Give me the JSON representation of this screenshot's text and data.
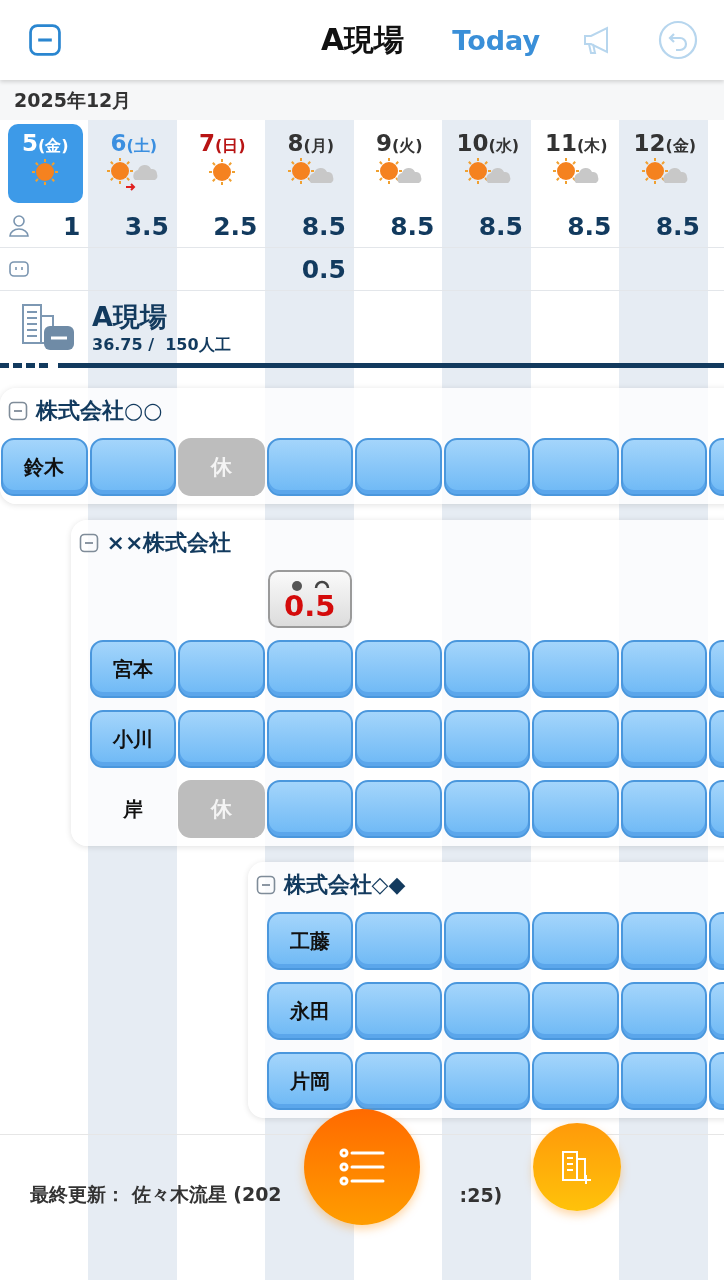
{
  "header": {
    "title": "A現場",
    "today": "Today"
  },
  "month": "2025年12月",
  "days": [
    {
      "day": "5",
      "weekday": "(金)",
      "color": "#ffffff",
      "selected": true,
      "weather": {
        "kind": "sunny"
      },
      "workers": "1"
    },
    {
      "day": "6",
      "weekday": "(土)",
      "color": "#3b8fe0",
      "selected": false,
      "weather": {
        "kind": "sunny_to_cloudy"
      },
      "workers": "3.5"
    },
    {
      "day": "7",
      "weekday": "(日)",
      "color": "#b81414",
      "selected": false,
      "weather": {
        "kind": "sunny"
      },
      "workers": "2.5"
    },
    {
      "day": "8",
      "weekday": "(月)",
      "color": "#333333",
      "selected": false,
      "weather": {
        "kind": "sunny_cloudy"
      },
      "workers": "8.5",
      "extra": "0.5"
    },
    {
      "day": "9",
      "weekday": "(火)",
      "color": "#333333",
      "selected": false,
      "weather": {
        "kind": "sunny_cloudy"
      },
      "workers": "8.5"
    },
    {
      "day": "10",
      "weekday": "(水)",
      "color": "#333333",
      "selected": false,
      "weather": {
        "kind": "sunny_cloudy"
      },
      "workers": "8.5"
    },
    {
      "day": "11",
      "weekday": "(木)",
      "color": "#333333",
      "selected": false,
      "weather": {
        "kind": "sunny_cloudy"
      },
      "workers": "8.5"
    },
    {
      "day": "12",
      "weekday": "(金)",
      "color": "#333333",
      "selected": false,
      "weather": {
        "kind": "sunny_cloudy"
      },
      "workers": "8.5"
    }
  ],
  "site": {
    "name": "A現場",
    "summary": "36.75 /  150人工"
  },
  "groups": [
    {
      "name": "株式会社○○",
      "expanded": true,
      "rows": [
        {
          "cells": [
            {
              "kind": "name",
              "text": "鈴木",
              "highlighted": true
            },
            {
              "kind": "work"
            },
            {
              "kind": "off",
              "text": "休"
            },
            {
              "kind": "work"
            },
            {
              "kind": "work"
            },
            {
              "kind": "work"
            },
            {
              "kind": "work"
            },
            {
              "kind": "work"
            },
            {
              "kind": "work"
            }
          ]
        }
      ]
    },
    {
      "name": "××株式会社",
      "expanded": true,
      "rows": [
        {
          "cells": [
            {
              "kind": "empty"
            },
            {
              "kind": "empty"
            },
            {
              "kind": "empty"
            },
            {
              "kind": "badge",
              "text": "0.5"
            }
          ]
        },
        {
          "cells": [
            {
              "kind": "empty"
            },
            {
              "kind": "name",
              "text": "宮本",
              "highlighted": true
            },
            {
              "kind": "work"
            },
            {
              "kind": "work"
            },
            {
              "kind": "work"
            },
            {
              "kind": "work"
            },
            {
              "kind": "work"
            },
            {
              "kind": "work"
            },
            {
              "kind": "work"
            }
          ]
        },
        {
          "cells": [
            {
              "kind": "empty"
            },
            {
              "kind": "name",
              "text": "小川",
              "highlighted": true
            },
            {
              "kind": "work"
            },
            {
              "kind": "work"
            },
            {
              "kind": "work"
            },
            {
              "kind": "work"
            },
            {
              "kind": "work"
            },
            {
              "kind": "work"
            },
            {
              "kind": "work"
            }
          ]
        },
        {
          "cells": [
            {
              "kind": "empty"
            },
            {
              "kind": "name",
              "text": "岸",
              "highlighted": false
            },
            {
              "kind": "off",
              "text": "休"
            },
            {
              "kind": "work"
            },
            {
              "kind": "work"
            },
            {
              "kind": "work"
            },
            {
              "kind": "work"
            },
            {
              "kind": "work"
            },
            {
              "kind": "work"
            }
          ]
        }
      ]
    },
    {
      "name": "株式会社◇◆",
      "expanded": true,
      "rows": [
        {
          "cells": [
            {
              "kind": "empty"
            },
            {
              "kind": "empty"
            },
            {
              "kind": "empty"
            },
            {
              "kind": "name",
              "text": "工藤",
              "highlighted": true
            },
            {
              "kind": "work"
            },
            {
              "kind": "work"
            },
            {
              "kind": "work"
            },
            {
              "kind": "work"
            },
            {
              "kind": "work"
            }
          ]
        },
        {
          "cells": [
            {
              "kind": "empty"
            },
            {
              "kind": "empty"
            },
            {
              "kind": "empty"
            },
            {
              "kind": "name",
              "text": "永田",
              "highlighted": true
            },
            {
              "kind": "work"
            },
            {
              "kind": "work"
            },
            {
              "kind": "work"
            },
            {
              "kind": "work"
            },
            {
              "kind": "work"
            }
          ]
        },
        {
          "cells": [
            {
              "kind": "empty"
            },
            {
              "kind": "empty"
            },
            {
              "kind": "empty"
            },
            {
              "kind": "name",
              "text": "片岡",
              "highlighted": true
            },
            {
              "kind": "work"
            },
            {
              "kind": "work"
            },
            {
              "kind": "work"
            },
            {
              "kind": "work"
            },
            {
              "kind": "work"
            }
          ]
        }
      ]
    }
  ],
  "footer": {
    "updated_start": "最終更新： 佐々木流星 (202",
    "updated_end": ":25)"
  }
}
